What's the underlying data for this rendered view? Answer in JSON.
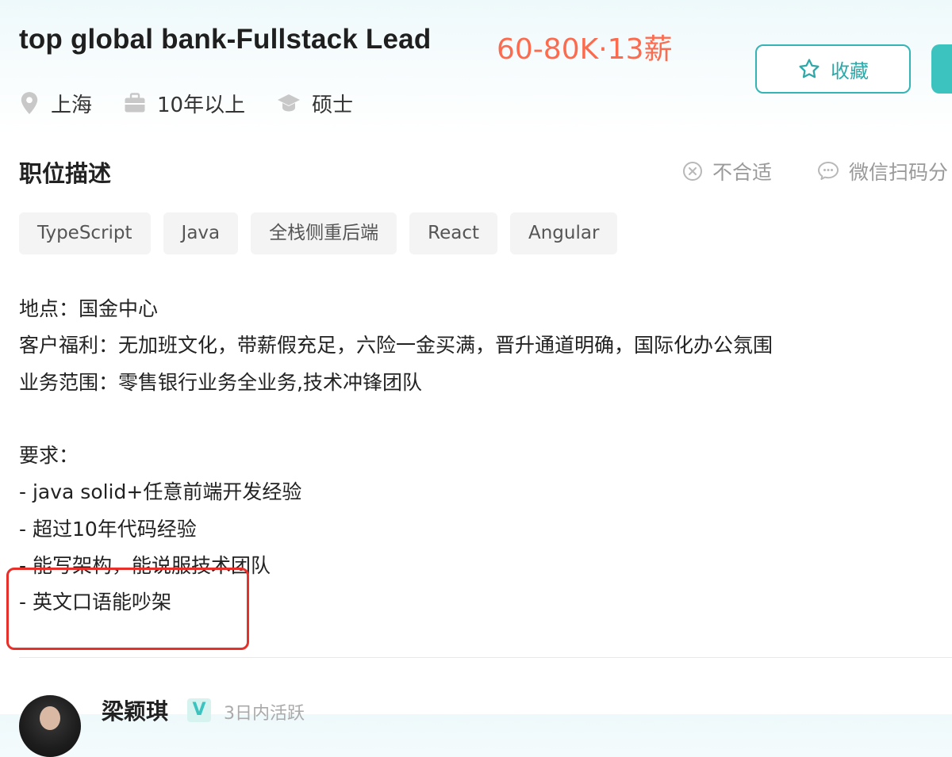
{
  "header": {
    "title": "top global bank-Fullstack Lead",
    "salary": "60-80K·13薪",
    "favorite_label": "收藏",
    "meta": {
      "location": "上海",
      "experience": "10年以上",
      "degree": "硕士"
    }
  },
  "section": {
    "title": "职位描述",
    "not_suitable_label": "不合适",
    "share_label": "微信扫码分"
  },
  "tags": [
    "TypeScript",
    "Java",
    "全栈侧重后端",
    "React",
    "Angular"
  ],
  "description": {
    "lines": [
      "地点：国金中心",
      "客户福利：无加班文化，带薪假充足，六险一金买满，晋升通道明确，国际化办公氛围",
      "业务范围：零售银行业务全业务,技术冲锋团队",
      "",
      "要求：",
      "- java solid+任意前端开发经验",
      "- 超过10年代码经验",
      "- 能写架构，能说服技术团队",
      "- 英文口语能吵架"
    ]
  },
  "recruiter": {
    "name": "梁颖琪",
    "badge": "V",
    "status": "3日内活跃"
  },
  "colors": {
    "salary": "#fd6b4f",
    "accent": "#34b4b4",
    "highlight": "#e8302a"
  },
  "icons": {
    "favorite": "star-outline-icon",
    "location": "location-pin-icon",
    "experience": "briefcase-icon",
    "degree": "graduation-cap-icon",
    "not_suitable": "close-circle-icon",
    "share": "wechat-icon"
  }
}
